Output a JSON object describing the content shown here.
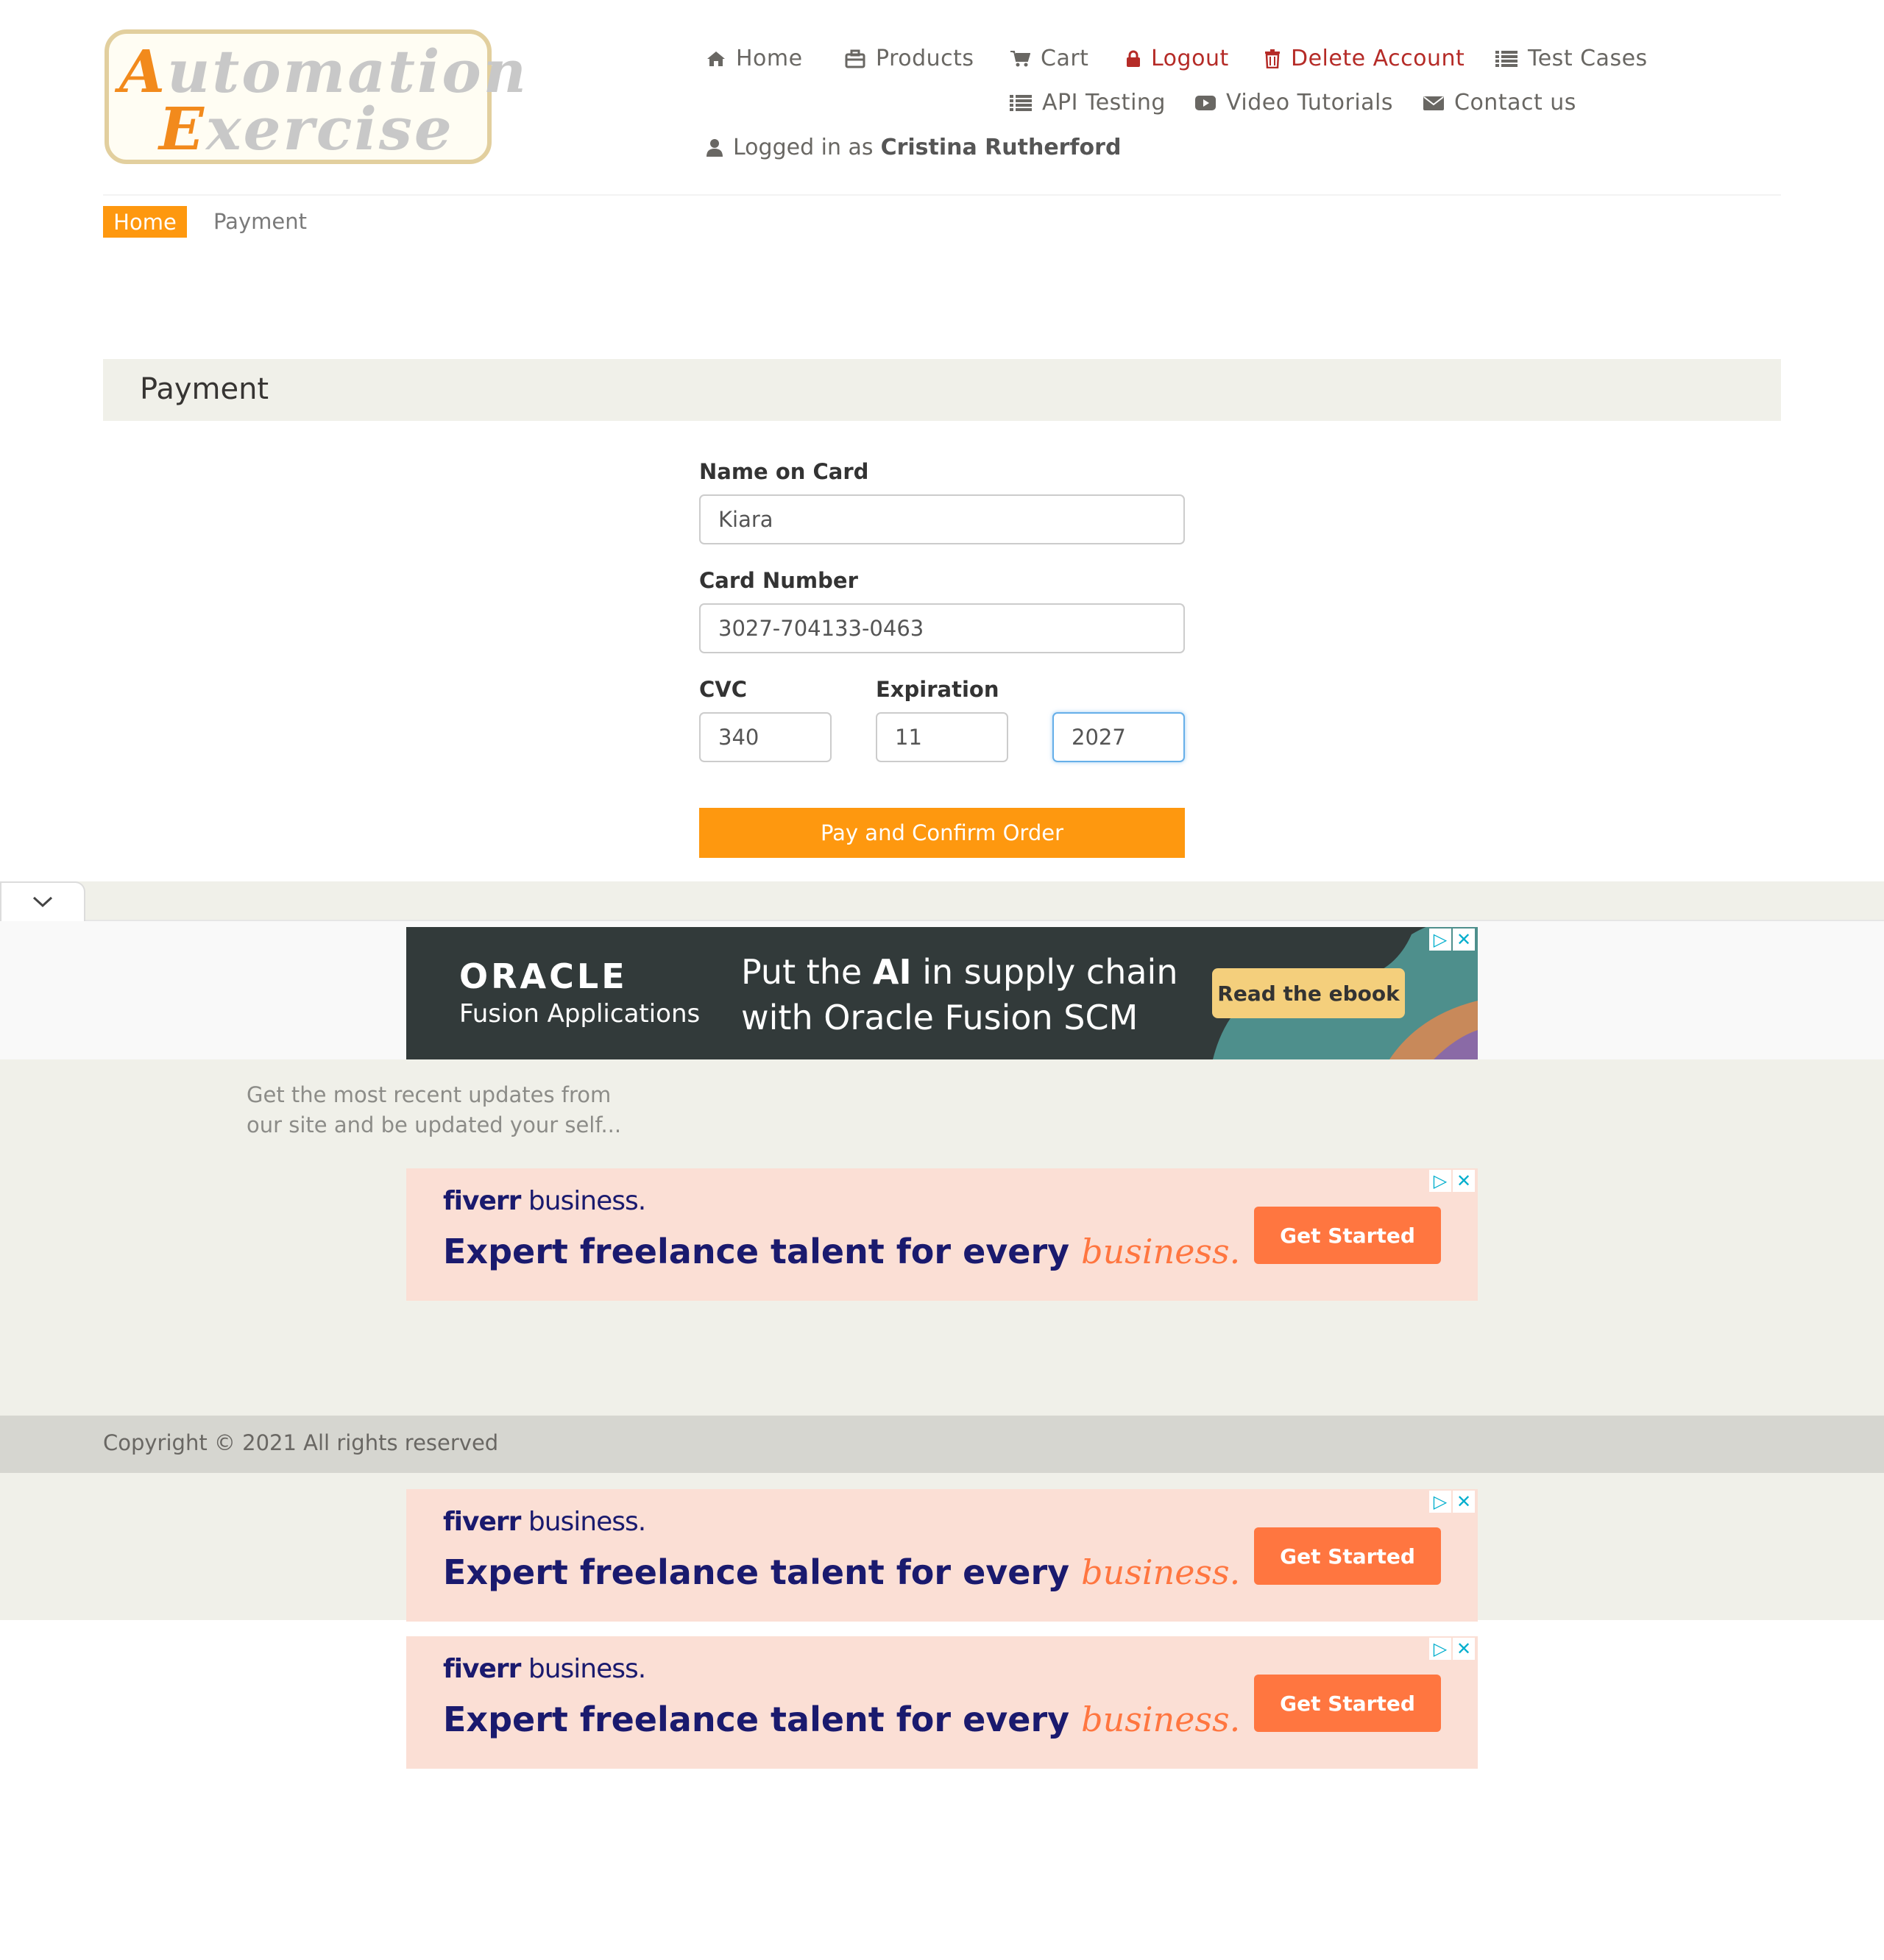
{
  "logo": {
    "line1_cap": "A",
    "line1_rest": "utomation",
    "line2_cap": "E",
    "line2_rest": "xercise"
  },
  "nav": {
    "home": "Home",
    "products": "Products",
    "cart": "Cart",
    "logout": "Logout",
    "delete_account": "Delete Account",
    "test_cases": "Test Cases",
    "api_testing": "API Testing",
    "video_tutorials": "Video Tutorials",
    "contact_us": "Contact us",
    "logged_in_as": "Logged in as",
    "user_name": "Cristina Rutherford"
  },
  "breadcrumb": {
    "home": "Home",
    "current": "Payment"
  },
  "page_title": "Payment",
  "form": {
    "name_label": "Name on Card",
    "name_value": "Kiara",
    "card_label": "Card Number",
    "card_value": "3027-704133-0463",
    "cvc_label": "CVC",
    "cvc_value": "340",
    "expiration_label": "Expiration",
    "exp_month_value": "11",
    "exp_year_value": "2027",
    "submit_label": "Pay and Confirm Order"
  },
  "footer": {
    "subscribe_text": "Get the most recent updates from our site and be updated your self...",
    "copyright": "Copyright © 2021 All rights reserved"
  },
  "ads": {
    "oracle": {
      "brand": "ORACLE",
      "sub": "Fusion Applications",
      "msg_pre": "Put the ",
      "msg_bold": "AI",
      "msg_post": " in supply chain with Oracle Fusion SCM",
      "cta": "Read the ebook"
    },
    "fiverr": {
      "brand_bold": "fiverr",
      "brand_rest": " business.",
      "msg": "Expert freelance talent for every ",
      "msg_italic": "business.",
      "cta": "Get Started"
    },
    "adchoices_icon": "▷",
    "close_icon": "✕"
  },
  "colors": {
    "accent": "#fe980f",
    "danger": "#b52b27",
    "nav_text": "#696763",
    "footer_bg": "#f0f0e9"
  }
}
